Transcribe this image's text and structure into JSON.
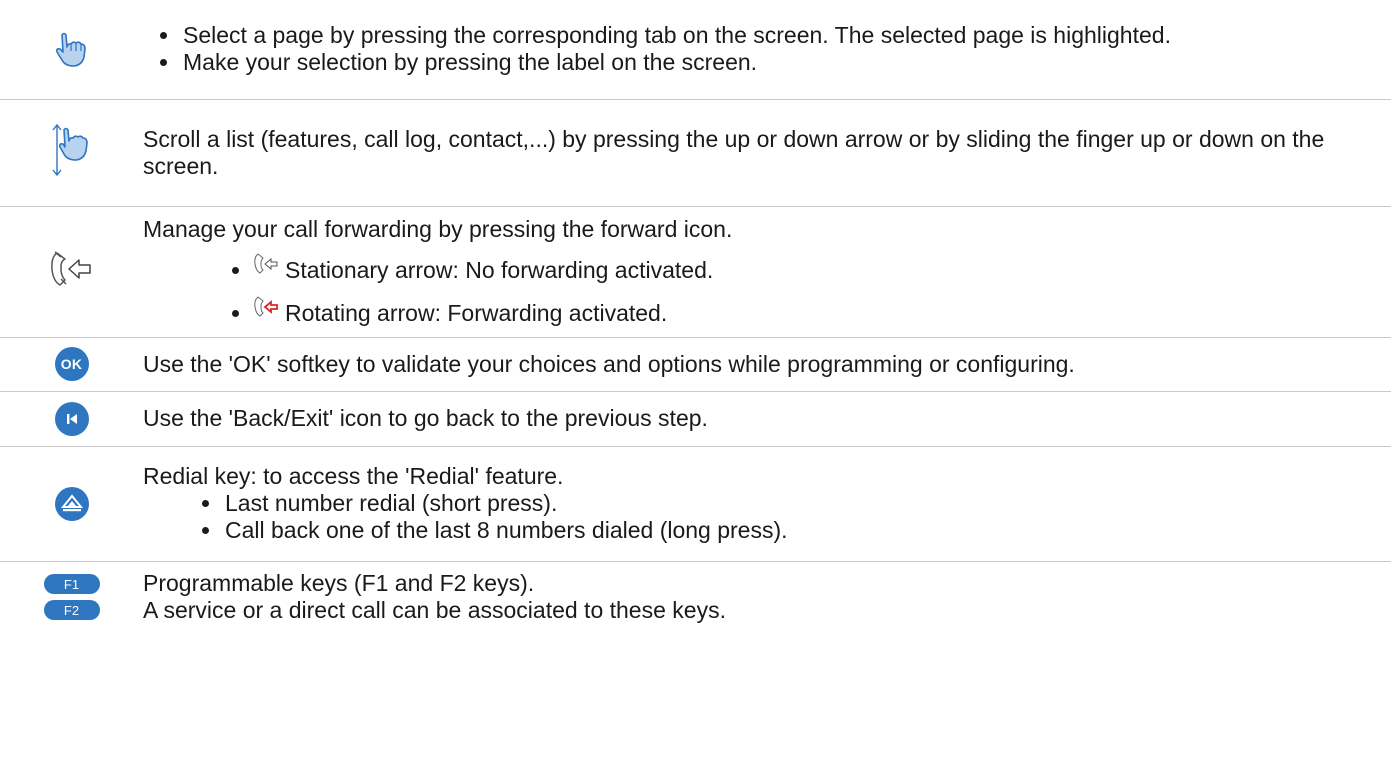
{
  "rows": {
    "navigate": {
      "icon": "hand-tap-icon",
      "bullets": [
        "Select a page by pressing the corresponding tab on the screen. The selected page is highlighted.",
        "Make your selection by pressing the label on the screen."
      ]
    },
    "scroll": {
      "icon": "hand-scroll-icon",
      "text": "Scroll a list (features, call log, contact,...) by pressing the up or down arrow or by sliding the finger up or down on the screen."
    },
    "forward": {
      "icon": "call-forward-icon",
      "intro": "Manage your call forwarding by pressing the forward icon.",
      "items": [
        {
          "icon": "call-forward-inactive-icon",
          "text": "Stationary arrow: No forwarding activated."
        },
        {
          "icon": "call-forward-active-icon",
          "text": "Rotating arrow: Forwarding activated."
        }
      ]
    },
    "ok": {
      "icon_label": "OK",
      "text": "Use the 'OK' softkey to validate your choices and options while programming or configuring."
    },
    "back": {
      "icon": "back-exit-icon",
      "text": "Use the 'Back/Exit' icon to go back to the previous step."
    },
    "redial": {
      "icon": "redial-icon",
      "intro": "Redial key: to access the 'Redial' feature.",
      "bullets": [
        "Last number redial (short press).",
        "Call back one of the last 8 numbers dialed (long press)."
      ]
    },
    "prog": {
      "keys": [
        "F1",
        "F2"
      ],
      "lines": [
        "Programmable keys (F1 and F2 keys).",
        "A service or a direct call can be associated to these keys."
      ]
    }
  },
  "colors": {
    "accent_blue": "#2f76c0",
    "hand_fill": "#b9d3ef",
    "active_arrow": "#d9262b",
    "divider": "#c8c8c8"
  }
}
